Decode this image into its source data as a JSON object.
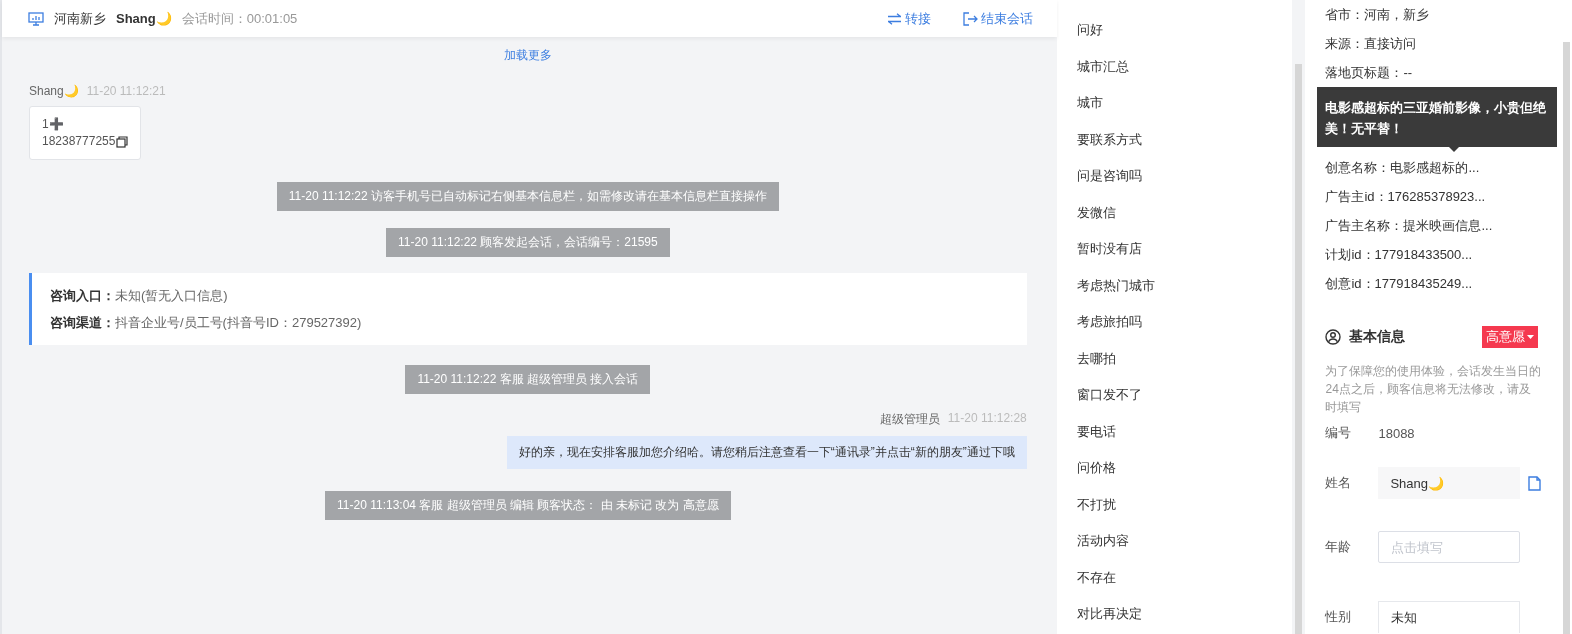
{
  "header": {
    "location": "河南新乡",
    "visitor": "Shang🌙",
    "duration_label": "会话时间：",
    "duration": "00:01:05",
    "actions": [
      {
        "kind": "transfer",
        "label": "转接"
      },
      {
        "kind": "end",
        "label": "结束会话"
      }
    ]
  },
  "chat": {
    "load_more": "加载更多",
    "messages": [
      {
        "kind": "visitor",
        "sender": "Shang🌙",
        "time": "11-20 11:12:21",
        "lines": [
          "1➕",
          "18238777255"
        ]
      },
      {
        "kind": "system",
        "text": "11-20 11:12:22 访客手机号已自动标记右侧基本信息栏，如需修改请在基本信息栏直接操作"
      },
      {
        "kind": "system",
        "text": "11-20 11:12:22 顾客发起会话，会话编号：21595"
      },
      {
        "kind": "info",
        "rows": [
          {
            "label": "咨询入口：",
            "value": "未知(暂无入口信息)"
          },
          {
            "label": "咨询渠道：",
            "value": "抖音企业号/员工号(抖音号ID：279527392)"
          }
        ]
      },
      {
        "kind": "system",
        "text": "11-20 11:12:22 客服 超级管理员 接入会话"
      },
      {
        "kind": "agent",
        "sender": "超级管理员",
        "time": "11-20 11:12:28",
        "text": "好的亲，现在安排客服加您介绍哈。请您稍后注意查看一下“通讯录”并点击“新的朋友”通过下哦"
      },
      {
        "kind": "system",
        "text": "11-20 11:13:04 客服 超级管理员 编辑 顾客状态： 由 未标记 改为 高意愿"
      }
    ]
  },
  "quick_replies": [
    "问好",
    "城市汇总",
    "城市",
    "要联系方式",
    "问是咨询吗",
    "发微信",
    "暂时没有店",
    "考虑热门城市",
    "考虑旅拍吗",
    "去哪拍",
    "窗口发不了",
    "要电话",
    "问价格",
    "不打扰",
    "活动内容",
    "不存在",
    "对比再决定"
  ],
  "source_info": [
    {
      "kind": "row",
      "text": "省市：河南，新乡"
    },
    {
      "kind": "row",
      "text": "来源：直接访问"
    },
    {
      "kind": "row",
      "text": "落地页标题：--"
    },
    {
      "kind": "tooltip",
      "text": "电影感超标的三亚婚前影像，小贵但绝美！无平替！"
    },
    {
      "kind": "row",
      "text": "创意名称：电影感超标的..."
    },
    {
      "kind": "row",
      "text": "广告主id：176285378923..."
    },
    {
      "kind": "row",
      "text": "广告主名称：提米映画信息..."
    },
    {
      "kind": "row",
      "text": "计划id：177918433500..."
    },
    {
      "kind": "row",
      "text": "创意id：177918435249..."
    }
  ],
  "basic_info": {
    "title": "基本信息",
    "status": "高意愿",
    "notice": "为了保障您的使用体验，会话发生当日的24点之后，顾客信息将无法修改，请及时填写",
    "fields": [
      {
        "kind": "text",
        "label": "编号",
        "value": "18088"
      },
      {
        "kind": "readonly",
        "label": "姓名",
        "value": "Shang🌙"
      },
      {
        "kind": "input",
        "label": "年龄",
        "placeholder": "点击填写"
      },
      {
        "kind": "select",
        "label": "性别",
        "value": "未知"
      }
    ]
  }
}
